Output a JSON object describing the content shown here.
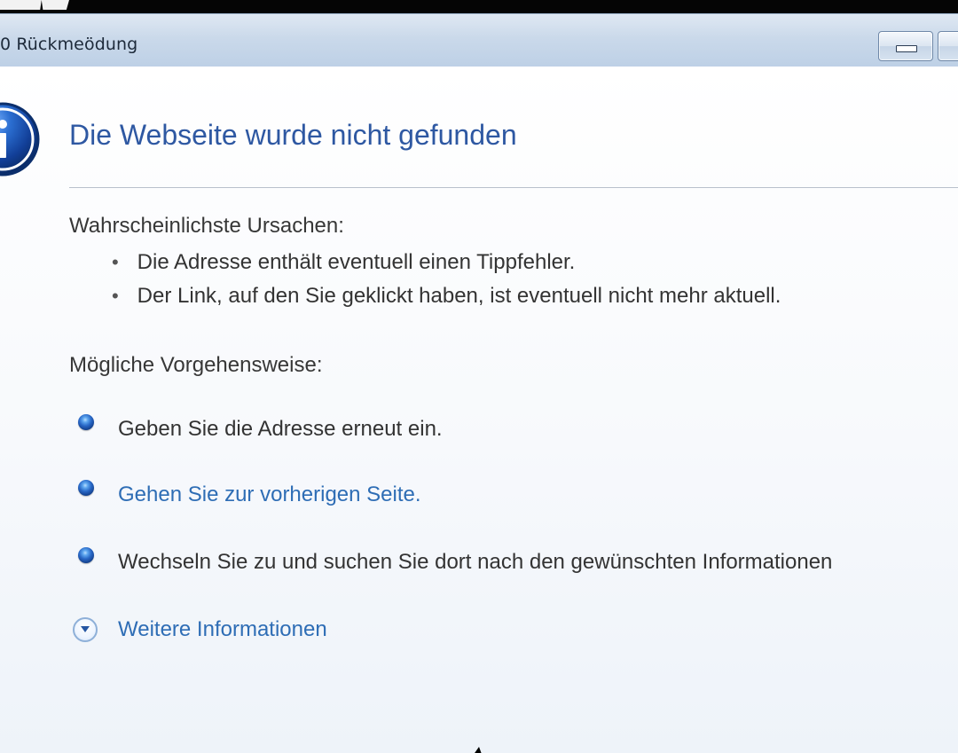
{
  "window": {
    "title": "0 Rückmeödung"
  },
  "error_page": {
    "heading": "Die Webseite wurde nicht gefunden",
    "reasons_label": "Wahrscheinlichste Ursachen:",
    "reasons": [
      "Die Adresse enthält eventuell einen Tippfehler.",
      "Der Link, auf den Sie geklickt haben, ist eventuell nicht mehr aktuell."
    ],
    "steps_label": "Mögliche Vorgehensweise:",
    "steps": [
      {
        "text": "Geben Sie die Adresse erneut ein.",
        "is_link": false
      },
      {
        "text": "Gehen Sie zur vorherigen Seite.",
        "is_link": true
      },
      {
        "text": "Wechseln Sie zu  und suchen Sie dort nach den gewünschten Informationen",
        "is_link": false
      }
    ],
    "more_info": "Weitere Informationen"
  },
  "icons": {
    "info": "info-icon",
    "bullet": "bullet-icon",
    "expand": "chevron-down-icon"
  },
  "colors": {
    "heading": "#2e58a2",
    "link": "#2e6db5",
    "text": "#333333"
  }
}
